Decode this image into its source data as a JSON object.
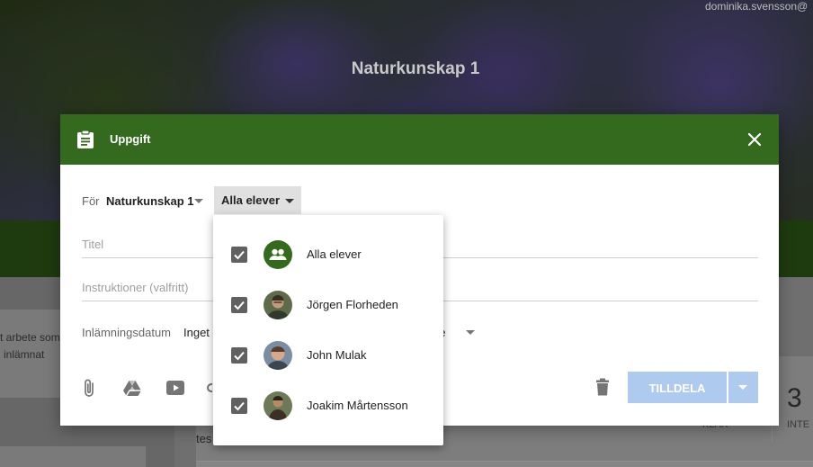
{
  "background": {
    "course_title": "Naturkunskap 1",
    "user_email": "dominika.svensson@",
    "left_snippet_line1": "t arbete som",
    "left_snippet_line2": "inlämnat",
    "feed_snippet": "tes",
    "stat_left_label": "KLAR",
    "stat_right_number": "3",
    "stat_right_label": "INTE"
  },
  "dialog": {
    "title": "Uppgift",
    "for_label": "För",
    "class_value": "Naturkunskap 1",
    "students_button": "Alla elever",
    "title_placeholder": "Titel",
    "instructions_placeholder": "Instruktioner (valfritt)",
    "due_label": "Inlämningsdatum",
    "due_value": "Inget",
    "topic_tail": "ne",
    "assign_button": "TILLDELA",
    "colors": {
      "header": "#336a1d",
      "assign_button": "#aecbef"
    }
  },
  "toolbar_icons": [
    "attach-icon",
    "drive-icon",
    "youtube-icon",
    "link-icon",
    "trash-icon"
  ],
  "student_menu": {
    "items": [
      {
        "label": "Alla elever",
        "checked": true,
        "avatar": "group-icon"
      },
      {
        "label": "Jörgen Florheden",
        "checked": true,
        "avatar": "photo"
      },
      {
        "label": "John Mulak",
        "checked": true,
        "avatar": "photo"
      },
      {
        "label": "Joakim Mårtensson",
        "checked": true,
        "avatar": "photo"
      }
    ]
  }
}
